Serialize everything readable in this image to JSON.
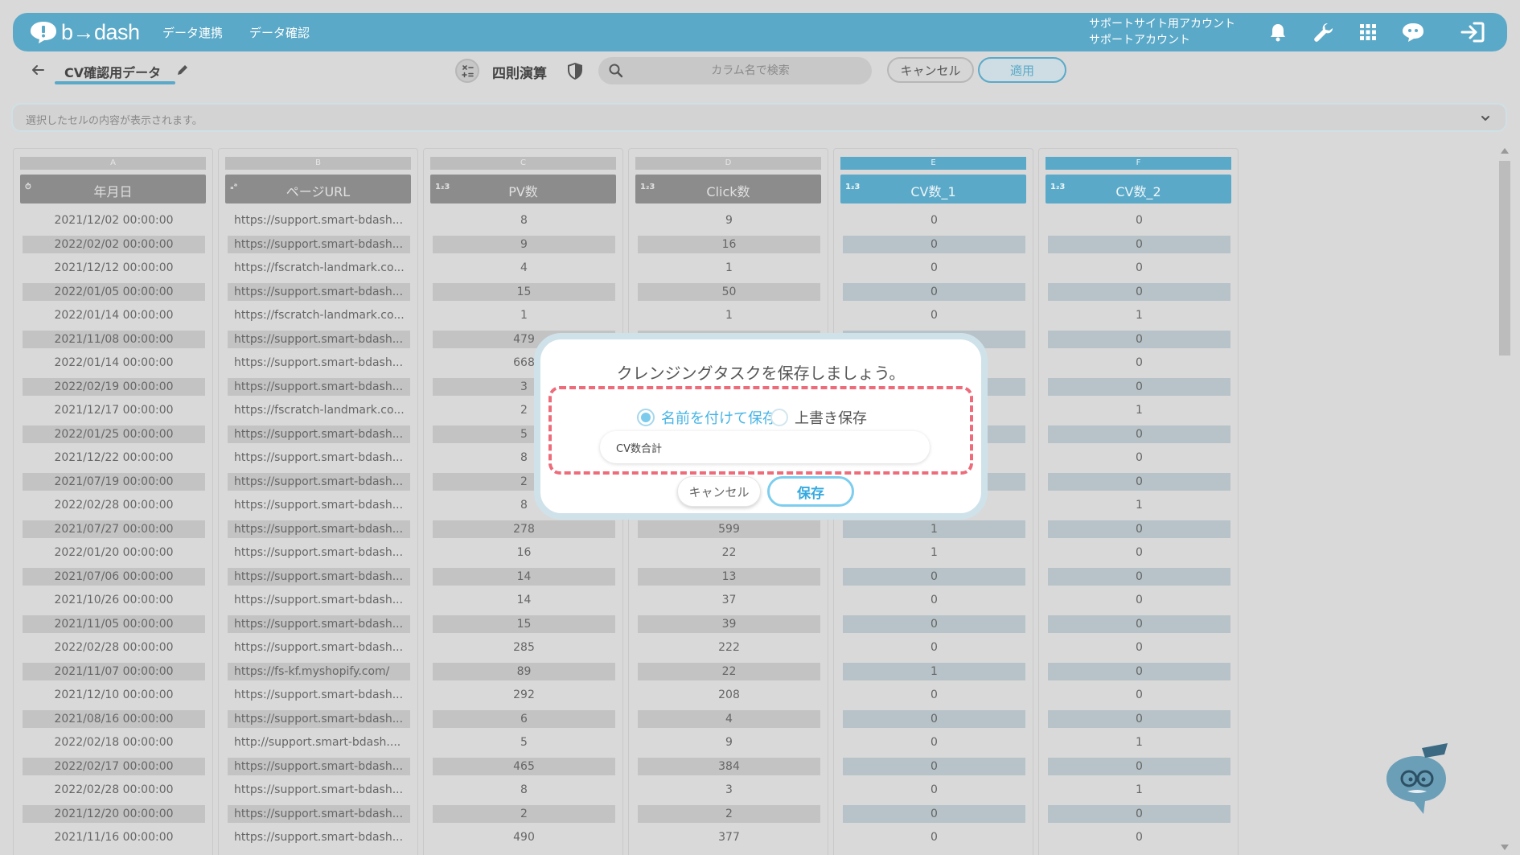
{
  "nav": {
    "logo_text": "b→dash",
    "links": [
      "データ連携",
      "データ確認"
    ],
    "account_line1": "サポートサイト用アカウント",
    "account_line2": "サポートアカウント",
    "icons": [
      "bell-icon",
      "wrench-icon",
      "apps-grid-icon",
      "chat-bubble-icon",
      "logout-icon"
    ],
    "accent": "#5ba9c8"
  },
  "toolbar": {
    "dataset_name": "CV確認用データ",
    "calc_label": "四則演算",
    "search_placeholder": "カラム名で検索",
    "cancel_label": "キャンセル",
    "apply_label": "適用"
  },
  "cellbar": {
    "placeholder": "選択したセルの内容が表示されます。"
  },
  "grid": {
    "columns": [
      {
        "letter": "A",
        "type_icon": "⏱",
        "name": "年月日",
        "selected": false
      },
      {
        "letter": "B",
        "type_icon": "ₐᵃ",
        "name": "ページURL",
        "selected": false
      },
      {
        "letter": "C",
        "type_icon": "1₂3",
        "name": "PV数",
        "selected": false
      },
      {
        "letter": "D",
        "type_icon": "1₂3",
        "name": "Click数",
        "selected": false
      },
      {
        "letter": "E",
        "type_icon": "1₂3",
        "name": "CV数_1",
        "selected": true
      },
      {
        "letter": "F",
        "type_icon": "1₂3",
        "name": "CV数_2",
        "selected": true
      }
    ],
    "rows": [
      [
        "2021/12/02 00:00:00",
        "https://support.smart-bdash...",
        "8",
        "9",
        "0",
        "0"
      ],
      [
        "2022/02/02 00:00:00",
        "https://support.smart-bdash...",
        "9",
        "16",
        "0",
        "0"
      ],
      [
        "2021/12/12 00:00:00",
        "https://fscratch-landmark.co...",
        "4",
        "1",
        "0",
        "0"
      ],
      [
        "2022/01/05 00:00:00",
        "https://support.smart-bdash...",
        "15",
        "50",
        "0",
        "0"
      ],
      [
        "2022/01/14 00:00:00",
        "https://fscratch-landmark.co...",
        "1",
        "1",
        "0",
        "1"
      ],
      [
        "2021/11/08 00:00:00",
        "https://support.smart-bdash...",
        "479",
        "",
        "",
        "0"
      ],
      [
        "2022/01/14 00:00:00",
        "https://support.smart-bdash...",
        "668",
        "",
        "",
        "0"
      ],
      [
        "2022/02/19 00:00:00",
        "https://support.smart-bdash...",
        "3",
        "",
        "",
        "0"
      ],
      [
        "2021/12/17 00:00:00",
        "https://fscratch-landmark.co...",
        "2",
        "",
        "",
        "1"
      ],
      [
        "2022/01/25 00:00:00",
        "https://support.smart-bdash...",
        "5",
        "",
        "",
        "0"
      ],
      [
        "2021/12/22 00:00:00",
        "https://support.smart-bdash...",
        "8",
        "",
        "",
        "0"
      ],
      [
        "2021/07/19 00:00:00",
        "https://support.smart-bdash...",
        "2",
        "",
        "",
        "0"
      ],
      [
        "2022/02/28 00:00:00",
        "https://support.smart-bdash...",
        "8",
        "",
        "",
        "1"
      ],
      [
        "2021/07/27 00:00:00",
        "https://support.smart-bdash...",
        "278",
        "599",
        "1",
        "0"
      ],
      [
        "2022/01/20 00:00:00",
        "https://support.smart-bdash...",
        "16",
        "22",
        "1",
        "0"
      ],
      [
        "2021/07/06 00:00:00",
        "https://support.smart-bdash...",
        "14",
        "13",
        "0",
        "0"
      ],
      [
        "2021/10/26 00:00:00",
        "https://support.smart-bdash...",
        "14",
        "37",
        "0",
        "0"
      ],
      [
        "2021/11/05 00:00:00",
        "https://support.smart-bdash...",
        "15",
        "39",
        "0",
        "0"
      ],
      [
        "2022/02/28 00:00:00",
        "https://support.smart-bdash...",
        "285",
        "222",
        "0",
        "0"
      ],
      [
        "2021/11/07 00:00:00",
        "https://fs-kf.myshopify.com/",
        "89",
        "22",
        "1",
        "0"
      ],
      [
        "2021/12/10 00:00:00",
        "https://support.smart-bdash...",
        "292",
        "208",
        "0",
        "0"
      ],
      [
        "2021/08/16 00:00:00",
        "https://support.smart-bdash...",
        "6",
        "4",
        "0",
        "0"
      ],
      [
        "2022/02/18 00:00:00",
        "http://support.smart-bdash....",
        "5",
        "9",
        "0",
        "1"
      ],
      [
        "2022/02/17 00:00:00",
        "https://support.smart-bdash...",
        "465",
        "384",
        "0",
        "0"
      ],
      [
        "2022/02/28 00:00:00",
        "https://support.smart-bdash...",
        "8",
        "3",
        "0",
        "1"
      ],
      [
        "2021/12/20 00:00:00",
        "https://support.smart-bdash...",
        "2",
        "2",
        "0",
        "0"
      ],
      [
        "2021/11/16 00:00:00",
        "https://support.smart-bdash...",
        "490",
        "377",
        "0",
        "0"
      ]
    ]
  },
  "modal": {
    "title": "クレンジングタスクを保存しましょう。",
    "option_save_as": "名前を付けて保存",
    "option_overwrite": "上書き保存",
    "selected_option": "save_as",
    "name_value": "CV数合計",
    "cancel_label": "キャンセル",
    "save_label": "保存",
    "highlight_color": "#ee6b7a"
  }
}
